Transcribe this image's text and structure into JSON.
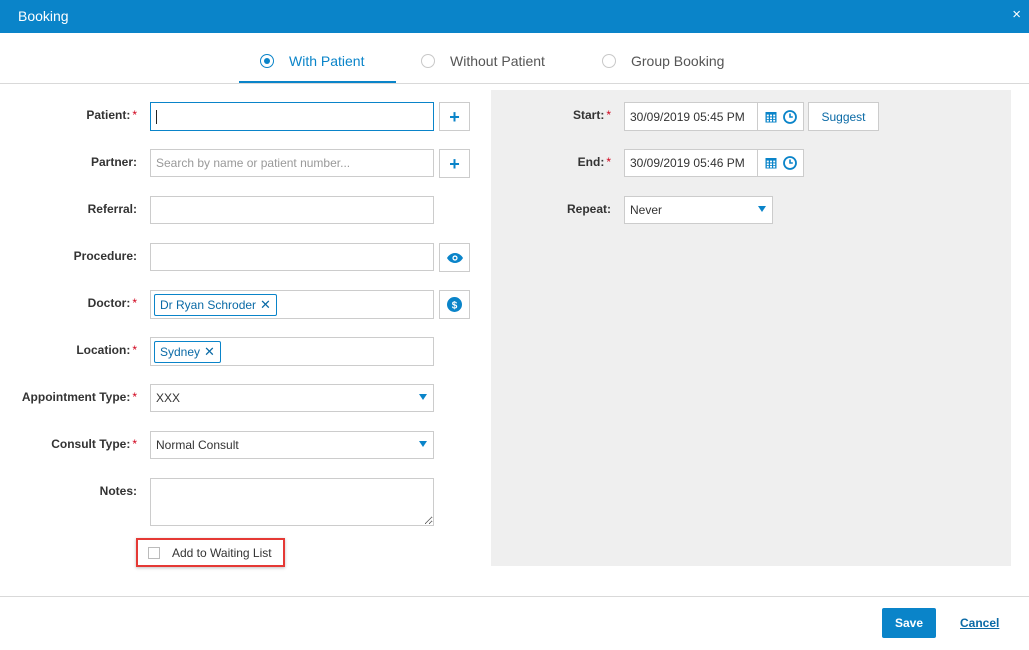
{
  "window": {
    "title": "Booking",
    "close_glyph": "×"
  },
  "tabs": [
    {
      "label": "With Patient",
      "active": true
    },
    {
      "label": "Without Patient",
      "active": false
    },
    {
      "label": "Group Booking",
      "active": false
    }
  ],
  "form": {
    "patient": {
      "label": "Patient:",
      "value": ""
    },
    "partner": {
      "label": "Partner:",
      "placeholder": "Search by name or patient number..."
    },
    "referral": {
      "label": "Referral:",
      "value": ""
    },
    "procedure": {
      "label": "Procedure:",
      "value": ""
    },
    "doctor": {
      "label": "Doctor:",
      "tag": "Dr Ryan Schroder"
    },
    "location": {
      "label": "Location:",
      "tag": "Sydney"
    },
    "appointment_type": {
      "label": "Appointment Type:",
      "value": "XXX"
    },
    "consult_type": {
      "label": "Consult Type:",
      "value": "Normal Consult"
    },
    "notes": {
      "label": "Notes:",
      "value": ""
    },
    "waiting_list": {
      "label": "Add to Waiting List",
      "checked": false
    }
  },
  "schedule": {
    "start": {
      "label": "Start:",
      "value": "30/09/2019 05:45 PM"
    },
    "end": {
      "label": "End:",
      "value": "30/09/2019 05:46 PM"
    },
    "repeat": {
      "label": "Repeat:",
      "value": "Never"
    },
    "suggest_label": "Suggest"
  },
  "footer": {
    "save_label": "Save",
    "cancel_label": "Cancel"
  },
  "glyphs": {
    "plus": "+",
    "remove": "✕",
    "required": "*"
  },
  "colors": {
    "accent": "#0a84c9",
    "required": "#d0021b",
    "highlight": "#e53935",
    "panel": "#efefef"
  },
  "icons": [
    "plus-icon",
    "eye-icon",
    "dollar-icon",
    "calendar-icon",
    "clock-icon",
    "dropdown-arrow-icon",
    "close-icon"
  ]
}
